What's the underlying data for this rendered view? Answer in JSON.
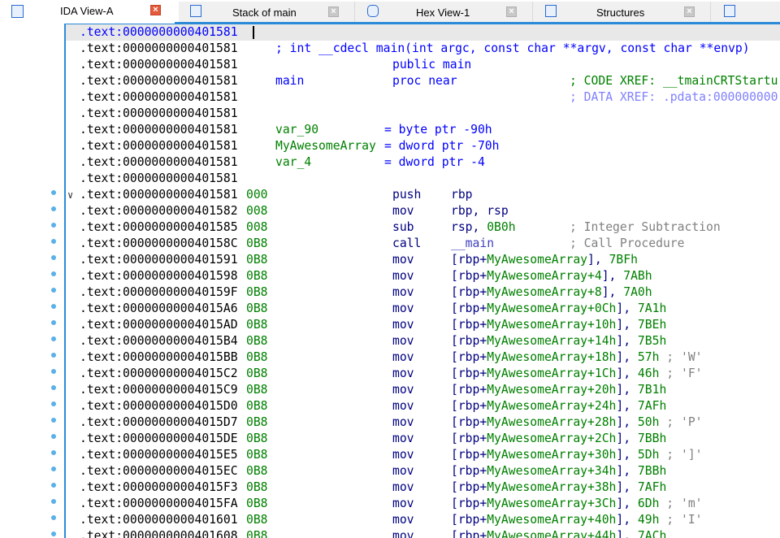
{
  "tabs": [
    {
      "label": "IDA View-A",
      "icon": "ida-view-icon",
      "active": true
    },
    {
      "label": "Stack of main",
      "icon": "stack-icon",
      "active": false
    },
    {
      "label": "Hex View-1",
      "icon": "hex-view-icon",
      "active": false
    },
    {
      "label": "Structures",
      "icon": "structures-icon",
      "active": false
    },
    {
      "label": "",
      "icon": "enums-icon",
      "active": false
    }
  ],
  "colors": {
    "accent": "#2a8ad8",
    "mnemonic": "#000080",
    "operand": "#008000",
    "comment": "#808080",
    "keyword": "#0000ff"
  },
  "rows": [
    {
      "addr": ".text:0000000000401581",
      "current": true,
      "segs": []
    },
    {
      "addr": ".text:0000000000401581",
      "segs": [
        {
          "col": "name",
          "t": "; int __cdecl main(int argc, const char **argv, const char **envp)",
          "c": "blue"
        }
      ]
    },
    {
      "addr": ".text:0000000000401581",
      "segs": [
        {
          "col": "mnem",
          "t": "public main",
          "c": "blue"
        }
      ]
    },
    {
      "addr": ".text:0000000000401581",
      "segs": [
        {
          "col": "name",
          "t": "main",
          "c": "blue"
        },
        {
          "col": "mnem",
          "t": "proc near",
          "c": "blue"
        },
        {
          "col": "cmt",
          "t": "; CODE XREF: __tmainCRTStartu",
          "c": "xref"
        }
      ]
    },
    {
      "addr": ".text:0000000000401581",
      "segs": [
        {
          "col": "cmt",
          "t": "; DATA XREF: .pdata:000000000",
          "c": "dxref"
        }
      ]
    },
    {
      "addr": ".text:0000000000401581",
      "segs": []
    },
    {
      "addr": ".text:0000000000401581",
      "segs": [
        {
          "col": "name",
          "t": "var_90",
          "c": "green"
        },
        {
          "col": "eq",
          "t": "= byte ptr -90h",
          "c": "blue"
        }
      ]
    },
    {
      "addr": ".text:0000000000401581",
      "segs": [
        {
          "col": "name",
          "t": "MyAwesomeArray",
          "c": "green"
        },
        {
          "col": "eq",
          "t": "= dword ptr -70h",
          "c": "blue"
        }
      ]
    },
    {
      "addr": ".text:0000000000401581",
      "segs": [
        {
          "col": "name",
          "t": "var_4",
          "c": "green"
        },
        {
          "col": "eq",
          "t": "= dword ptr -4",
          "c": "blue"
        }
      ]
    },
    {
      "addr": ".text:0000000000401581",
      "segs": []
    },
    {
      "addr": ".text:0000000000401581",
      "sp": "000",
      "code": true,
      "fold": true,
      "mnem": "push",
      "ops": [
        {
          "t": "rbp",
          "c": "navy"
        }
      ]
    },
    {
      "addr": ".text:0000000000401582",
      "sp": "008",
      "code": true,
      "mnem": "mov",
      "ops": [
        {
          "t": "rbp, rsp",
          "c": "navy"
        }
      ]
    },
    {
      "addr": ".text:0000000000401585",
      "sp": "008",
      "code": true,
      "mnem": "sub",
      "ops": [
        {
          "t": "rsp, ",
          "c": "navy"
        },
        {
          "t": "0B0h",
          "c": "green"
        }
      ],
      "comment": "; Integer Subtraction"
    },
    {
      "addr": ".text:000000000040158C",
      "sp": "0B8",
      "code": true,
      "mnem": "call",
      "ops": [
        {
          "t": "__main",
          "c": "purple"
        }
      ],
      "comment": "; Call Procedure"
    },
    {
      "addr": ".text:0000000000401591",
      "sp": "0B8",
      "code": true,
      "mnem": "mov",
      "arr": "MyAwesomeArray",
      "val": "7BFh"
    },
    {
      "addr": ".text:0000000000401598",
      "sp": "0B8",
      "code": true,
      "mnem": "mov",
      "arr": "MyAwesomeArray+4",
      "val": "7ABh"
    },
    {
      "addr": ".text:000000000040159F",
      "sp": "0B8",
      "code": true,
      "mnem": "mov",
      "arr": "MyAwesomeArray+8",
      "val": "7A0h"
    },
    {
      "addr": ".text:00000000004015A6",
      "sp": "0B8",
      "code": true,
      "mnem": "mov",
      "arr": "MyAwesomeArray+0Ch",
      "val": "7A1h"
    },
    {
      "addr": ".text:00000000004015AD",
      "sp": "0B8",
      "code": true,
      "mnem": "mov",
      "arr": "MyAwesomeArray+10h",
      "val": "7BEh"
    },
    {
      "addr": ".text:00000000004015B4",
      "sp": "0B8",
      "code": true,
      "mnem": "mov",
      "arr": "MyAwesomeArray+14h",
      "val": "7B5h"
    },
    {
      "addr": ".text:00000000004015BB",
      "sp": "0B8",
      "code": true,
      "mnem": "mov",
      "arr": "MyAwesomeArray+18h",
      "val": "57h",
      "ch": "; 'W'"
    },
    {
      "addr": ".text:00000000004015C2",
      "sp": "0B8",
      "code": true,
      "mnem": "mov",
      "arr": "MyAwesomeArray+1Ch",
      "val": "46h",
      "ch": "; 'F'"
    },
    {
      "addr": ".text:00000000004015C9",
      "sp": "0B8",
      "code": true,
      "mnem": "mov",
      "arr": "MyAwesomeArray+20h",
      "val": "7B1h"
    },
    {
      "addr": ".text:00000000004015D0",
      "sp": "0B8",
      "code": true,
      "mnem": "mov",
      "arr": "MyAwesomeArray+24h",
      "val": "7AFh"
    },
    {
      "addr": ".text:00000000004015D7",
      "sp": "0B8",
      "code": true,
      "mnem": "mov",
      "arr": "MyAwesomeArray+28h",
      "val": "50h",
      "ch": "; 'P'"
    },
    {
      "addr": ".text:00000000004015DE",
      "sp": "0B8",
      "code": true,
      "mnem": "mov",
      "arr": "MyAwesomeArray+2Ch",
      "val": "7BBh"
    },
    {
      "addr": ".text:00000000004015E5",
      "sp": "0B8",
      "code": true,
      "mnem": "mov",
      "arr": "MyAwesomeArray+30h",
      "val": "5Dh",
      "ch": "; ']'"
    },
    {
      "addr": ".text:00000000004015EC",
      "sp": "0B8",
      "code": true,
      "mnem": "mov",
      "arr": "MyAwesomeArray+34h",
      "val": "7BBh"
    },
    {
      "addr": ".text:00000000004015F3",
      "sp": "0B8",
      "code": true,
      "mnem": "mov",
      "arr": "MyAwesomeArray+38h",
      "val": "7AFh"
    },
    {
      "addr": ".text:00000000004015FA",
      "sp": "0B8",
      "code": true,
      "mnem": "mov",
      "arr": "MyAwesomeArray+3Ch",
      "val": "6Dh",
      "ch": "; 'm'"
    },
    {
      "addr": ".text:0000000000401601",
      "sp": "0B8",
      "code": true,
      "mnem": "mov",
      "arr": "MyAwesomeArray+40h",
      "val": "49h",
      "ch": "; 'I'"
    },
    {
      "addr": ".text:0000000000401608",
      "sp": "0B8",
      "code": true,
      "mnem": "mov",
      "arr": "MyAwesomeArray+44h",
      "val": "7ACh"
    }
  ]
}
